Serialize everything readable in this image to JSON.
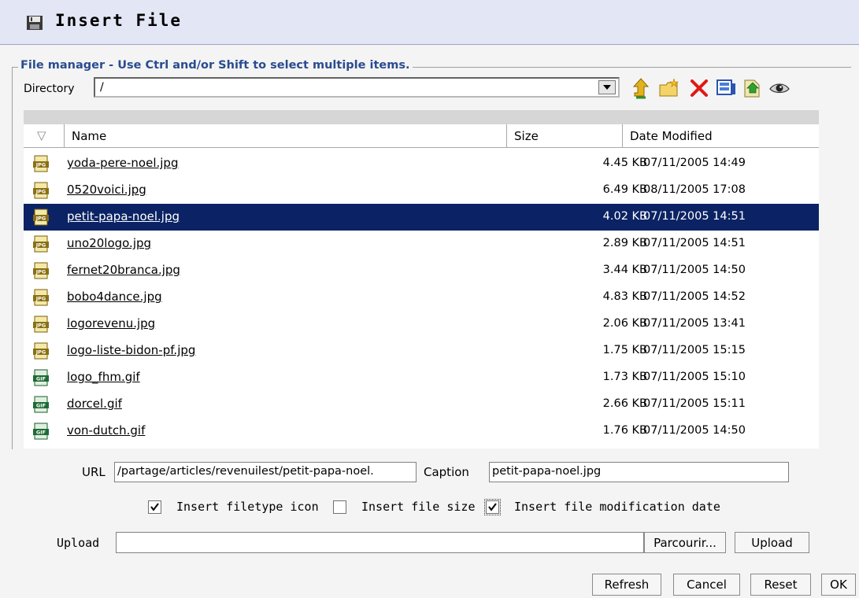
{
  "window": {
    "title": "Insert File",
    "title_icon": "floppy-disk-icon"
  },
  "file_manager": {
    "legend": "File manager - Use Ctrl and/or Shift to select multiple items.",
    "directory_label": "Directory",
    "directory_value": "/",
    "toolbar_icons": [
      "up-folder-icon",
      "new-folder-icon",
      "delete-icon",
      "thumbnail-view-icon",
      "upload-icon",
      "preview-eye-icon"
    ],
    "columns": {
      "sort": "▽",
      "name": "Name",
      "size": "Size",
      "date": "Date Modified"
    },
    "files": [
      {
        "type": "JPG",
        "name": "yoda-pere-noel.jpg",
        "size": "4.45 KB",
        "date": "07/11/2005 14:49",
        "selected": false
      },
      {
        "type": "JPG",
        "name": "0520voici.jpg",
        "size": "6.49 KB",
        "date": "08/11/2005 17:08",
        "selected": false
      },
      {
        "type": "JPG",
        "name": "petit-papa-noel.jpg",
        "size": "4.02 KB",
        "date": "07/11/2005 14:51",
        "selected": true
      },
      {
        "type": "JPG",
        "name": "uno20logo.jpg",
        "size": "2.89 KB",
        "date": "07/11/2005 14:51",
        "selected": false
      },
      {
        "type": "JPG",
        "name": "fernet20branca.jpg",
        "size": "3.44 KB",
        "date": "07/11/2005 14:50",
        "selected": false
      },
      {
        "type": "JPG",
        "name": "bobo4dance.jpg",
        "size": "4.83 KB",
        "date": "07/11/2005 14:52",
        "selected": false
      },
      {
        "type": "JPG",
        "name": "logorevenu.jpg",
        "size": "2.06 KB",
        "date": "07/11/2005 13:41",
        "selected": false
      },
      {
        "type": "JPG",
        "name": "logo-liste-bidon-pf.jpg",
        "size": "1.75 KB",
        "date": "07/11/2005 15:15",
        "selected": false
      },
      {
        "type": "GIF",
        "name": "logo_fhm.gif",
        "size": "1.73 KB",
        "date": "07/11/2005 15:10",
        "selected": false
      },
      {
        "type": "GIF",
        "name": "dorcel.gif",
        "size": "2.66 KB",
        "date": "07/11/2005 15:11",
        "selected": false
      },
      {
        "type": "GIF",
        "name": "von-dutch.gif",
        "size": "1.76 KB",
        "date": "07/11/2005 14:50",
        "selected": false
      }
    ]
  },
  "form": {
    "url_label": "URL",
    "url_value": "/partage/articles/revenuilest/petit-papa-noel.",
    "caption_label": "Caption",
    "caption_value": "petit-papa-noel.jpg",
    "options": [
      {
        "label": "Insert filetype icon",
        "checked": true
      },
      {
        "label": "Insert file size",
        "checked": false
      },
      {
        "label": "Insert file modification date",
        "checked": true
      }
    ],
    "upload_label": "Upload",
    "upload_value": "",
    "browse_button": "Parcourir...",
    "upload_button": "Upload"
  },
  "footer": {
    "refresh": "Refresh",
    "cancel": "Cancel",
    "reset": "Reset",
    "ok": "OK"
  },
  "colors": {
    "selection": "#0b2364",
    "legend": "#2a4c8f",
    "titlebar": "#e3e6f4",
    "jpg_icon": "#8a6f14",
    "gif_icon": "#1e6b35"
  }
}
